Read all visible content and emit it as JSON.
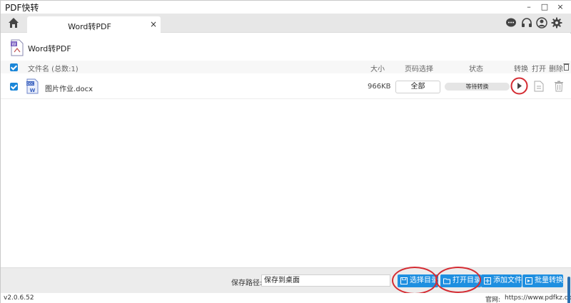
{
  "app": {
    "title": "PDF快转"
  },
  "window_controls": {
    "minimize": "–",
    "maximize": "□",
    "close": "×"
  },
  "tabs": [
    {
      "label": "Word转PDF",
      "close": "×"
    }
  ],
  "section": {
    "title": "Word转PDF"
  },
  "table": {
    "headers": {
      "filename": "文件名 (总数:1)",
      "size": "大小",
      "pages": "页码选择",
      "status": "状态",
      "convert": "转换",
      "open": "打开",
      "delete": "删除"
    },
    "rows": [
      {
        "filename": "图片作业.docx",
        "size": "966KB",
        "pages": "全部",
        "status": "等待转换",
        "file_icon_badge": "DOC",
        "file_icon_letter": "W"
      }
    ]
  },
  "bottom": {
    "save_label": "保存路径:",
    "save_value": "保存到桌面",
    "buttons": {
      "choose_dir": "选择目录",
      "open_dir": "打开目录",
      "add_file": "添加文件",
      "batch": "批量转换"
    }
  },
  "footer": {
    "version": "v2.0.6.52",
    "site_label": "官网:",
    "site_url": "https://www.pdfkz.com"
  },
  "colors": {
    "accent": "#1f8fe0",
    "checkbox": "#1a86d8",
    "annotation_ring": "#d42b32"
  },
  "icons": [
    "home-icon",
    "chat-icon",
    "headset-icon",
    "user-icon",
    "gear-icon",
    "play-icon",
    "open-file-icon",
    "trash-icon"
  ]
}
